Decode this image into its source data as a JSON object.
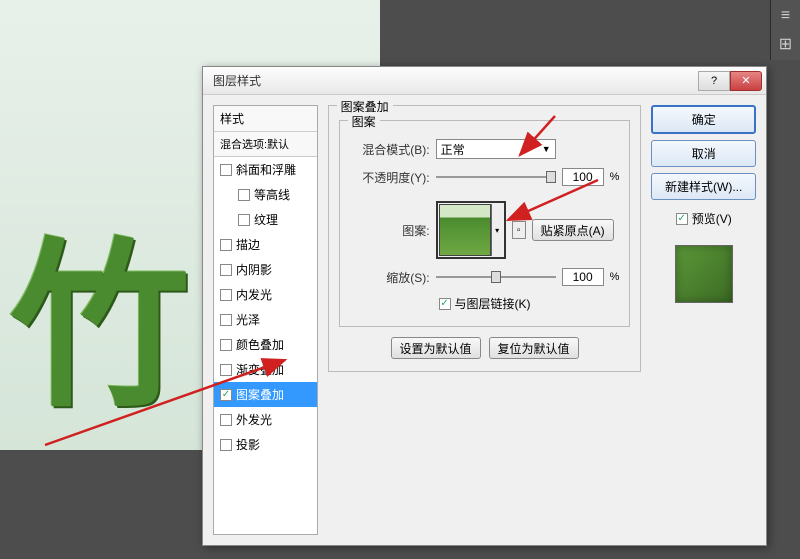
{
  "canvas": {
    "text": "竹"
  },
  "dialog": {
    "title": "图层样式",
    "styles": {
      "header": "样式",
      "blend_options": "混合选项:默认",
      "items": [
        {
          "key": "bevel",
          "label": "斜面和浮雕",
          "checked": false,
          "indent": false
        },
        {
          "key": "contour",
          "label": "等高线",
          "checked": false,
          "indent": true
        },
        {
          "key": "texture",
          "label": "纹理",
          "checked": false,
          "indent": true
        },
        {
          "key": "stroke",
          "label": "描边",
          "checked": false,
          "indent": false
        },
        {
          "key": "innershadow",
          "label": "内阴影",
          "checked": false,
          "indent": false
        },
        {
          "key": "innerglow",
          "label": "内发光",
          "checked": false,
          "indent": false
        },
        {
          "key": "satin",
          "label": "光泽",
          "checked": false,
          "indent": false
        },
        {
          "key": "coloroverlay",
          "label": "颜色叠加",
          "checked": false,
          "indent": false
        },
        {
          "key": "gradientoverlay",
          "label": "渐变叠加",
          "checked": false,
          "indent": false
        },
        {
          "key": "patternoverlay",
          "label": "图案叠加",
          "checked": true,
          "indent": false,
          "selected": true
        },
        {
          "key": "outerglow",
          "label": "外发光",
          "checked": false,
          "indent": false
        },
        {
          "key": "dropshadow",
          "label": "投影",
          "checked": false,
          "indent": false
        }
      ]
    },
    "settings": {
      "group_title": "图案叠加",
      "inner_title": "图案",
      "blend_mode_label": "混合模式(B):",
      "blend_mode_value": "正常",
      "opacity_label": "不透明度(Y):",
      "opacity_value": "100",
      "percent": "%",
      "pattern_label": "图案:",
      "snap_label": "贴紧原点(A)",
      "scale_label": "缩放(S):",
      "scale_value": "100",
      "link_label": "与图层链接(K)",
      "set_default": "设置为默认值",
      "reset_default": "复位为默认值"
    },
    "buttons": {
      "ok": "确定",
      "cancel": "取消",
      "new_style": "新建样式(W)...",
      "preview": "预览(V)"
    }
  }
}
